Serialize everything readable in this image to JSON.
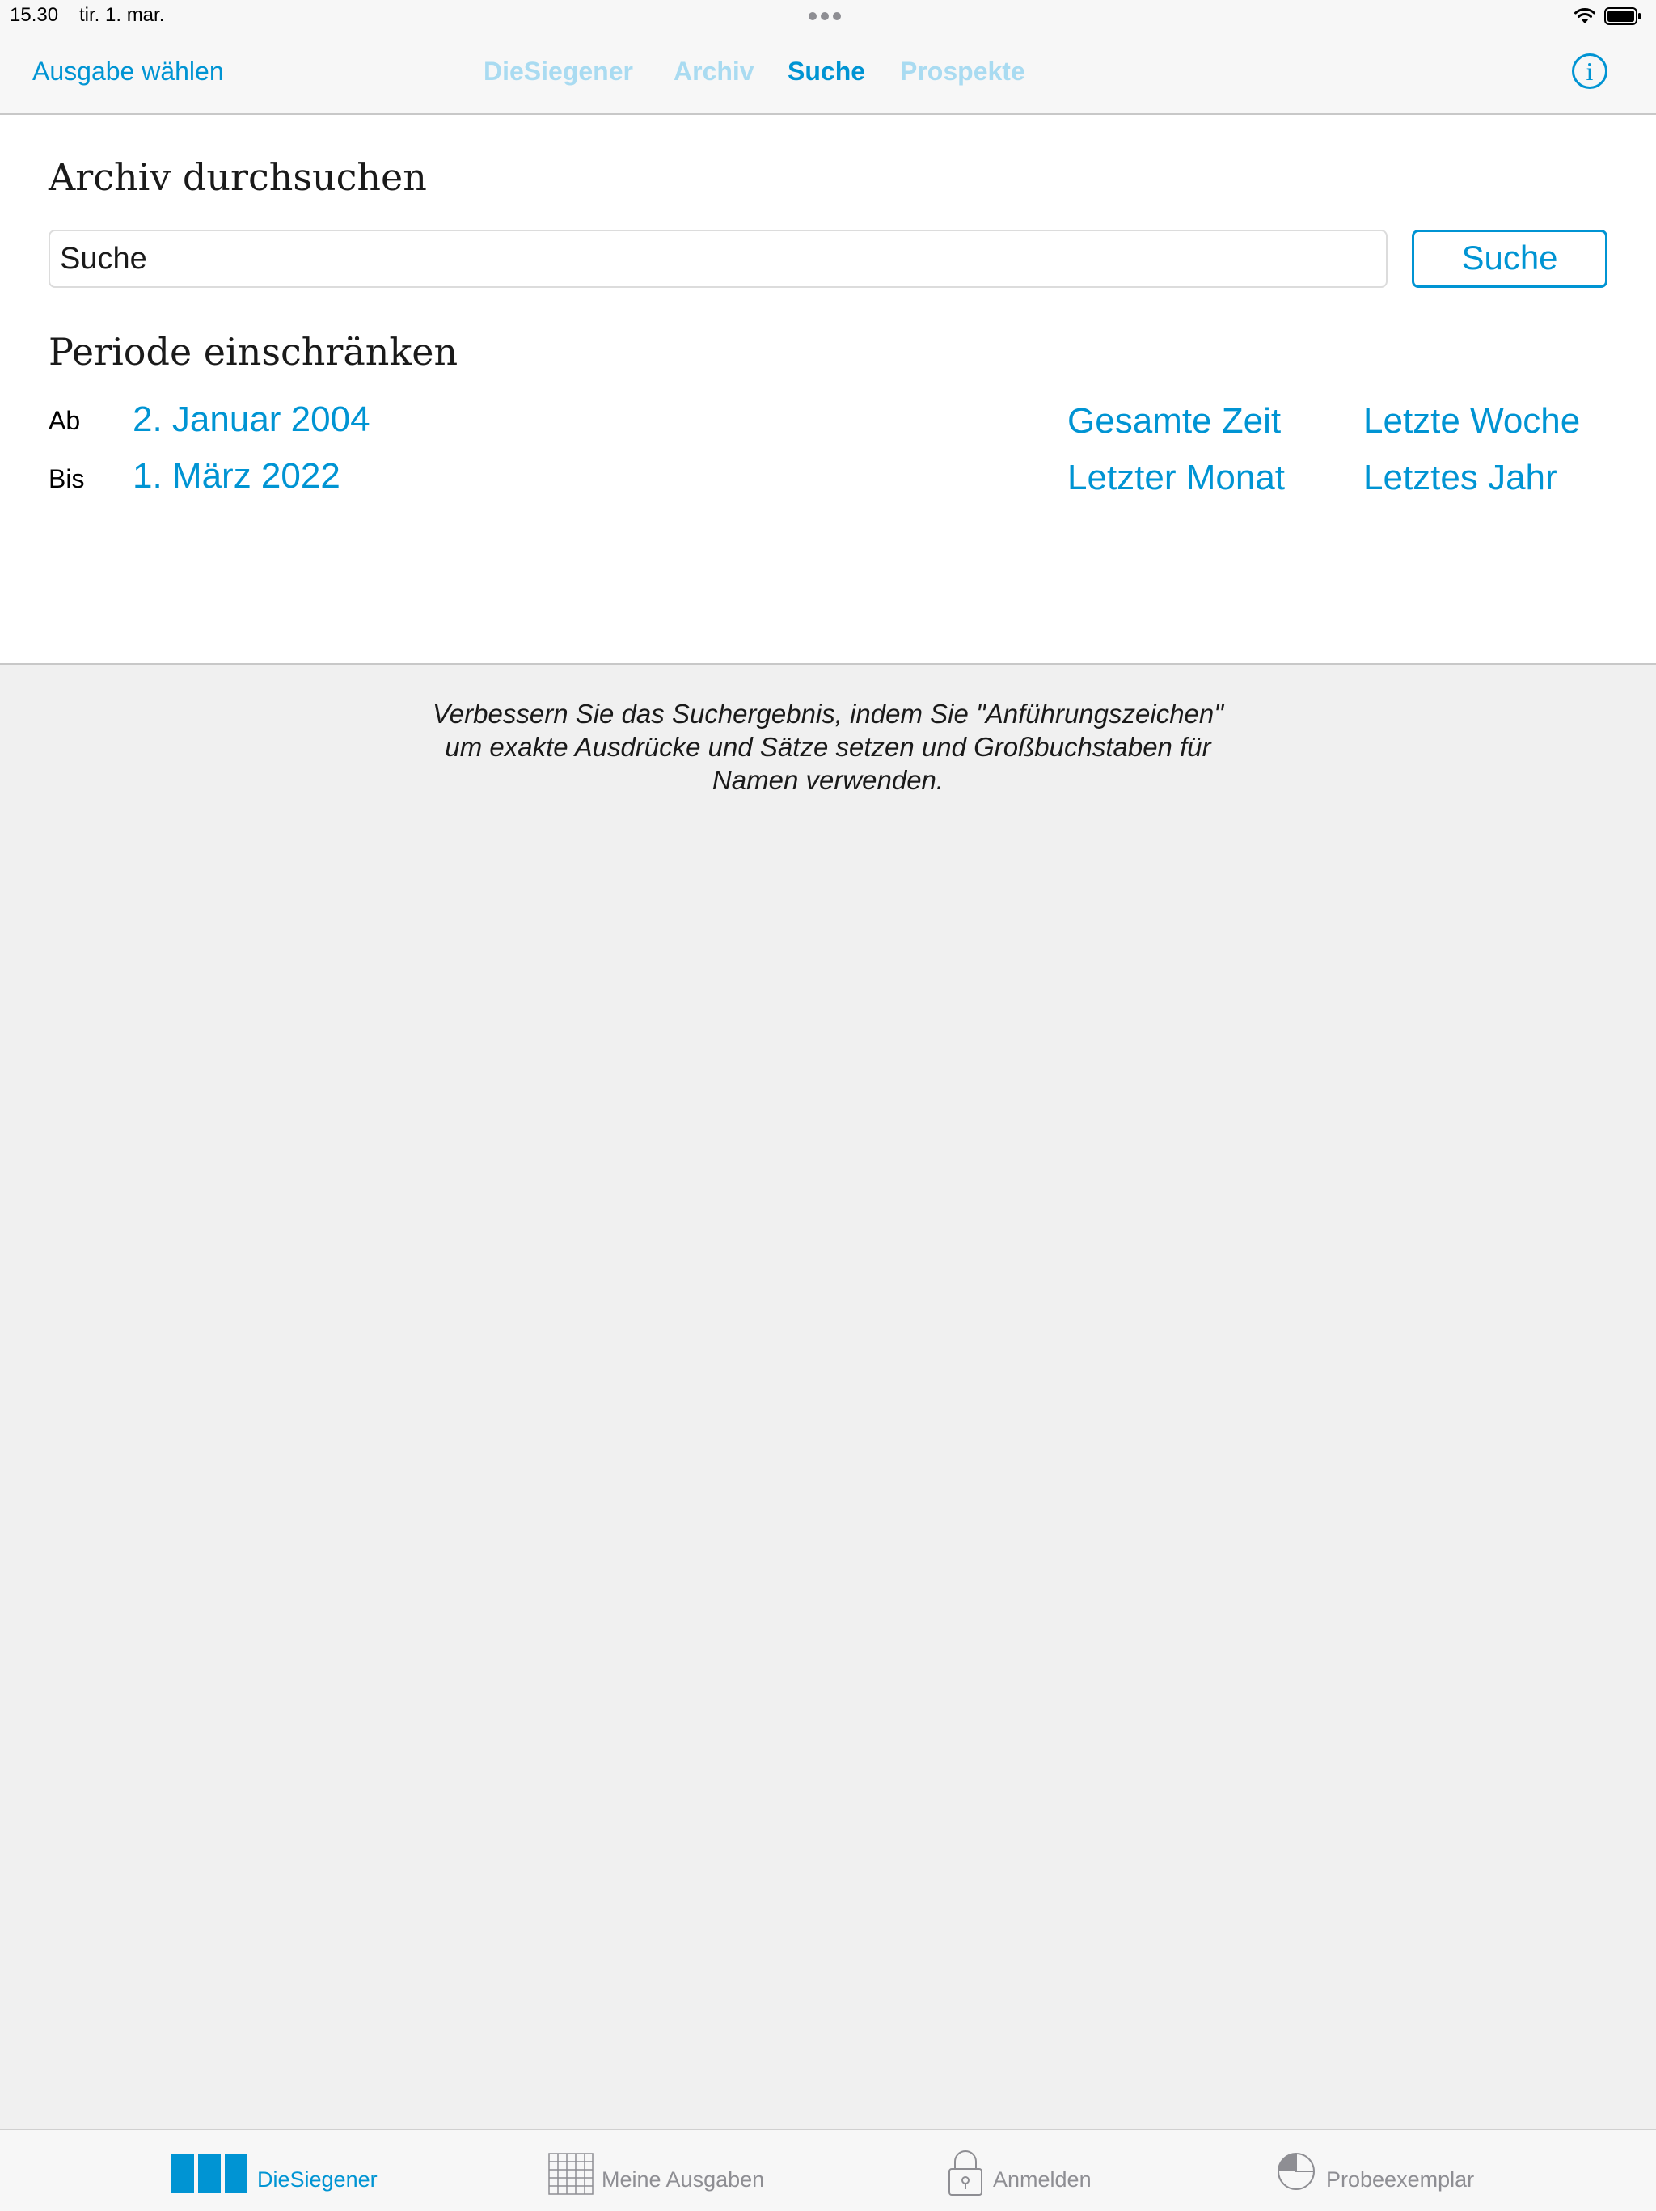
{
  "status_bar": {
    "time": "15.30",
    "date": "tir. 1. mar."
  },
  "nav": {
    "left_button": "Ausgabe wählen",
    "segments": [
      "DieSiegener",
      "Archiv",
      "Suche",
      "Prospekte"
    ],
    "active_segment": "Suche",
    "info_glyph": "i"
  },
  "search": {
    "heading": "Archiv durchsuchen",
    "input_placeholder": "Suche",
    "button_label": "Suche"
  },
  "period": {
    "heading": "Periode einschränken",
    "from_label": "Ab",
    "from_value": "2. Januar 2004",
    "to_label": "Bis",
    "to_value": "1. März 2022",
    "quick_ranges": [
      "Gesamte Zeit",
      "Letzte Woche",
      "Letzter Monat",
      "Letztes Jahr"
    ]
  },
  "hint": {
    "lines": [
      "Verbessern Sie das Suchergebnis, indem Sie \"Anführungszeichen\"",
      "um exakte Ausdrücke und Sätze setzen und Großbuchstaben für",
      "Namen verwenden."
    ]
  },
  "tab_bar": {
    "items": [
      {
        "label": "DieSiegener",
        "icon": "newspaper-pages-icon",
        "active": true
      },
      {
        "label": "Meine Ausgaben",
        "icon": "grid-icon",
        "active": false
      },
      {
        "label": "Anmelden",
        "icon": "lock-icon",
        "active": false
      },
      {
        "label": "Probeexemplar",
        "icon": "pie-icon",
        "active": false
      }
    ]
  },
  "colors": {
    "accent": "#0094d3",
    "accent_inactive": "#a9dbf1",
    "tab_inactive": "#8e8e93",
    "background": "#f0f0f0",
    "panel": "#ffffff"
  }
}
